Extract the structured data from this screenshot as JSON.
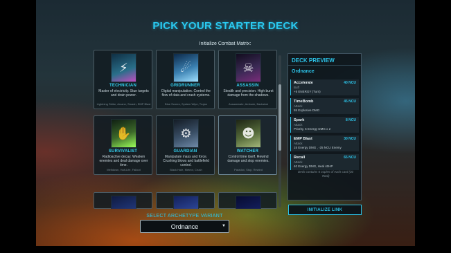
{
  "header": {
    "title": "PICK YOUR STARTER DECK",
    "subtitle": "Initialize Combat Matrix:"
  },
  "cards": [
    {
      "name": "TECHNICIAN",
      "description": "Master of electricity. Stun targets and drain power.",
      "skills": "Lightning Strike, Arcane, Smash, EMP Blast",
      "icon": "circuit-icon",
      "art_color": "#2a6f8a"
    },
    {
      "name": "GRIDRUNNER",
      "description": "Digital manipulation. Control the flow of data and crash systems.",
      "skills": "Blue Screen, System Wipe, Trojan",
      "icon": "hologram-icon",
      "art_color": "#3a7fb0"
    },
    {
      "name": "ASSASSIN",
      "description": "Stealth and precision. High burst damage from the shadows.",
      "skills": "Assassinate, Ambush, Backstab",
      "icon": "hood-icon",
      "art_color": "#3b2a55"
    },
    {
      "name": "SURVIVALIST",
      "description": "Radioactive decay. Weaken enemies and deal damage over time.",
      "skills": "Meltdown, Half-Life, Fallout",
      "icon": "hand-icon",
      "art_color": "#3d6a2a"
    },
    {
      "name": "GUARDIAN",
      "description": "Manipulate mass and force. Crushing blows and battlefield control.",
      "skills": "Black Hole, Meteor, Crush",
      "icon": "mech-icon",
      "art_color": "#3a4f66"
    },
    {
      "name": "WATCHER",
      "description": "Control time itself. Rewind damage and stop enemies.",
      "skills": "Paradox, Stop, Rewind",
      "icon": "orc-icon",
      "art_color": "#556a3a"
    },
    {
      "name": "",
      "description": "",
      "skills": "",
      "icon": "partial-art-icon",
      "art_color": "#2c4aa0"
    },
    {
      "name": "",
      "description": "",
      "skills": "",
      "icon": "partial-art-icon",
      "art_color": "#3d5fc0"
    },
    {
      "name": "",
      "description": "",
      "skills": "",
      "icon": "partial-art-icon",
      "art_color": "#1a2a7a"
    }
  ],
  "archetype_select": {
    "label": "SELECT ARCHETYPE VARIANT",
    "value": "Ordnance"
  },
  "deck_preview": {
    "title": "DECK PREVIEW",
    "archetype": "Ordnance",
    "items": [
      {
        "name": "Accelerate",
        "cost": "40 NCU",
        "type": "Buff",
        "effect": "+5 ENERGY (Turn)"
      },
      {
        "name": "TimeBomb",
        "cost": "45 NCU",
        "type": "Attack",
        "effect": "55 Explosive DMG"
      },
      {
        "name": "Spark",
        "cost": "8 NCU",
        "type": "Attack",
        "effect": "Priority, 6 Energy DMG x 2"
      },
      {
        "name": "EMP Blast",
        "cost": "30 NCU",
        "type": "Attack",
        "effect": "15 Energy DMG , -25 NCU Enemy"
      },
      {
        "name": "Recall",
        "cost": "65 NCU",
        "type": "Attack",
        "effect": "40 Energy DMG, Heal 40HP"
      }
    ],
    "note": "Deck contains 6 copies of each card (30 Total)",
    "button_label": "INITIALIZE LINK"
  },
  "colors": {
    "accent": "#29c9f0",
    "panel": "#0e161c"
  }
}
